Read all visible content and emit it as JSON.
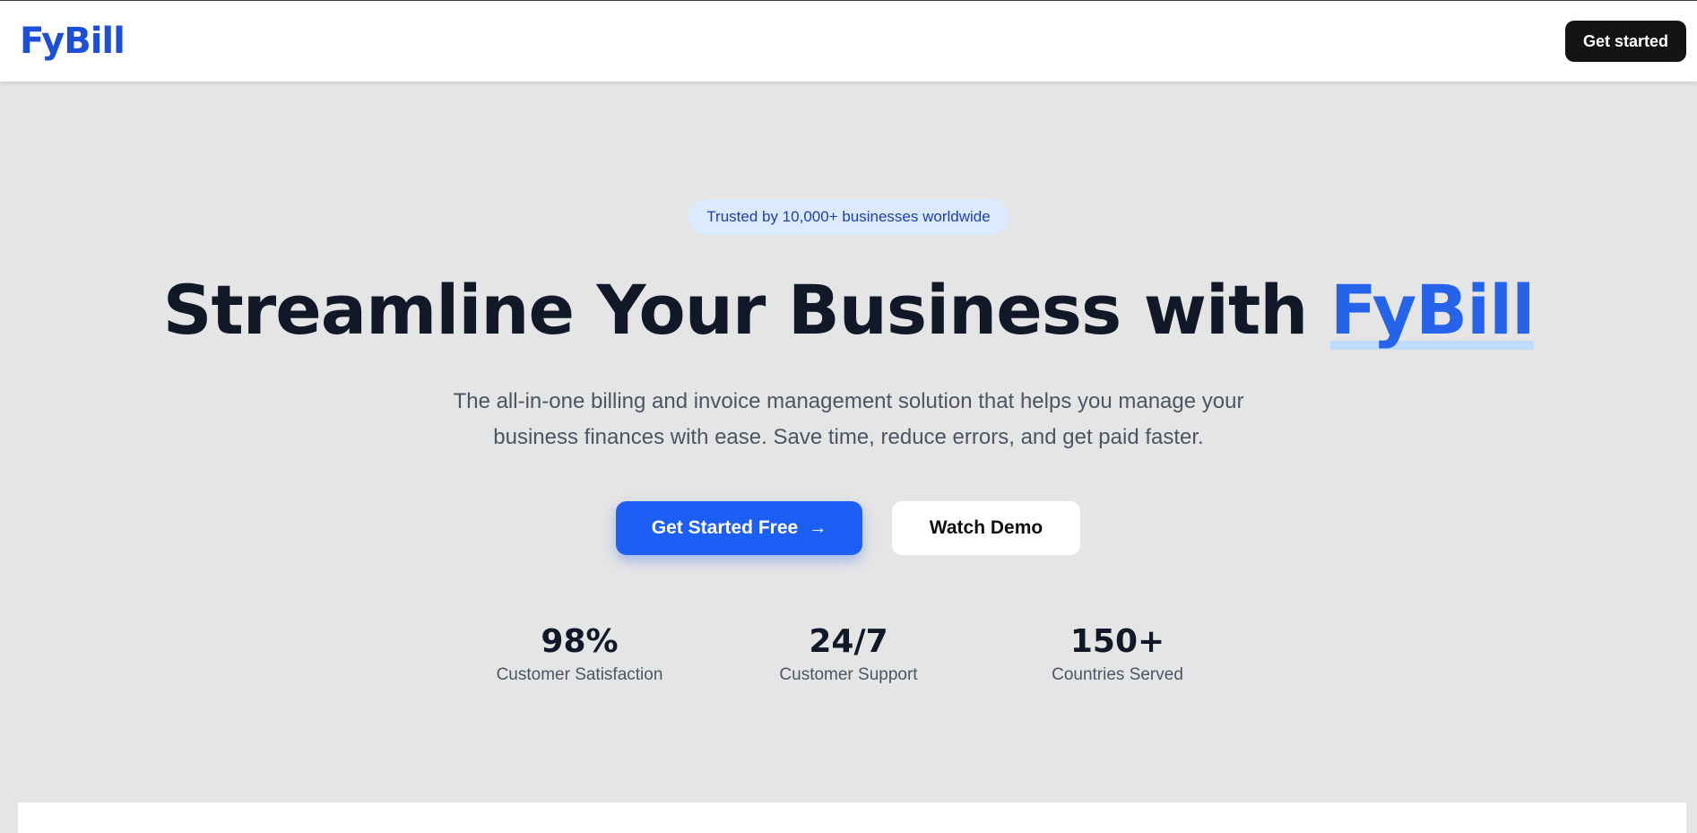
{
  "header": {
    "logo": "FyBill",
    "cta_label": "Get started"
  },
  "hero": {
    "badge": "Trusted by 10,000+ businesses worldwide",
    "headline_prefix": "Streamline Your Business with ",
    "headline_brand": "FyBill",
    "subtitle_line1": "The all-in-one billing and invoice management solution that helps you manage your",
    "subtitle_line2": "business finances with ease. Save time, reduce errors, and get paid faster.",
    "primary_button": "Get Started Free",
    "primary_button_icon": "arrow-right-icon",
    "secondary_button": "Watch Demo"
  },
  "stats": [
    {
      "value": "98%",
      "label": "Customer Satisfaction"
    },
    {
      "value": "24/7",
      "label": "Customer Support"
    },
    {
      "value": "150+",
      "label": "Countries Served"
    }
  ],
  "colors": {
    "brand": "#1d4ed8",
    "primary_button": "#1d5ef5",
    "badge_bg": "#dbeafe",
    "page_bg": "#e5e5e5"
  }
}
